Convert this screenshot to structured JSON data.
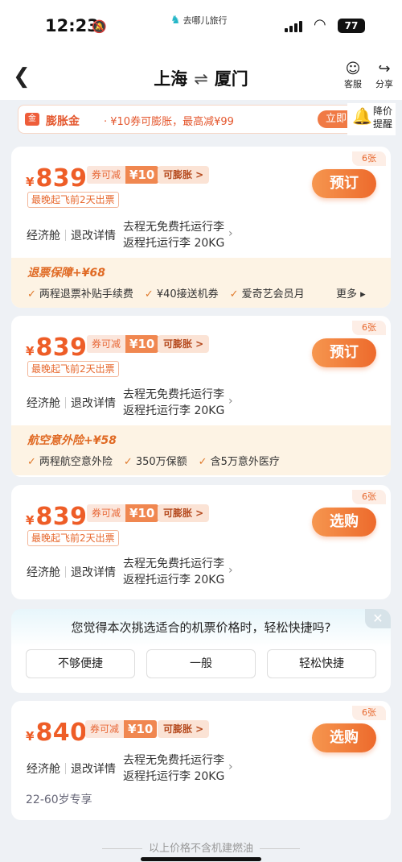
{
  "status": {
    "time": "12:23",
    "app": "去哪儿旅行",
    "battery": "77"
  },
  "nav": {
    "from": "上海",
    "swap": "⇌",
    "to": "厦门",
    "service": "客服",
    "share": "分享"
  },
  "promo": {
    "icon_text": "金",
    "title": "膨胀金",
    "text": "· ¥10券可膨胀，最高减¥99",
    "button": "立即",
    "alert_label": "降价提醒"
  },
  "cards": [
    {
      "yen": "¥",
      "price": "839",
      "coupon_label": "券可减",
      "coupon_value": "¥10",
      "expand": "可膨胀 >",
      "deadline": "最晚起飞前2天出票",
      "stock": "6张",
      "action": "预订",
      "cabin": "经济舱",
      "refund": "退改详情",
      "bag1": "去程无免费托运行李",
      "bag2": "返程托运行李 20KG",
      "addon": {
        "title": "退票保障+¥68",
        "items": [
          "两程退票补贴手续费",
          "¥40接送机券",
          "爱奇艺会员月"
        ],
        "more": "更多 ▸"
      }
    },
    {
      "yen": "¥",
      "price": "839",
      "coupon_label": "券可减",
      "coupon_value": "¥10",
      "expand": "可膨胀 >",
      "deadline": "最晚起飞前2天出票",
      "stock": "6张",
      "action": "预订",
      "cabin": "经济舱",
      "refund": "退改详情",
      "bag1": "去程无免费托运行李",
      "bag2": "返程托运行李 20KG",
      "addon": {
        "title": "航空意外险+¥58",
        "items": [
          "两程航空意外险",
          "350万保额",
          "含5万意外医疗"
        ]
      }
    },
    {
      "yen": "¥",
      "price": "839",
      "coupon_label": "券可减",
      "coupon_value": "¥10",
      "expand": "可膨胀 >",
      "deadline": "最晚起飞前2天出票",
      "stock": "6张",
      "action": "选购",
      "cabin": "经济舱",
      "refund": "退改详情",
      "bag1": "去程无免费托运行李",
      "bag2": "返程托运行李 20KG"
    },
    {
      "yen": "¥",
      "price": "840",
      "coupon_label": "券可减",
      "coupon_value": "¥10",
      "expand": "可膨胀 >",
      "stock": "6张",
      "action": "选购",
      "cabin": "经济舱",
      "refund": "退改详情",
      "bag1": "去程无免费托运行李",
      "bag2": "返程托运行李 20KG",
      "tag": "22-60岁专享"
    }
  ],
  "survey": {
    "question": "您觉得本次挑选适合的机票价格时，轻松快捷吗?",
    "options": [
      "不够便捷",
      "一般",
      "轻松快捷"
    ],
    "close": "✕"
  },
  "footer": "以上价格不含机建燃油"
}
